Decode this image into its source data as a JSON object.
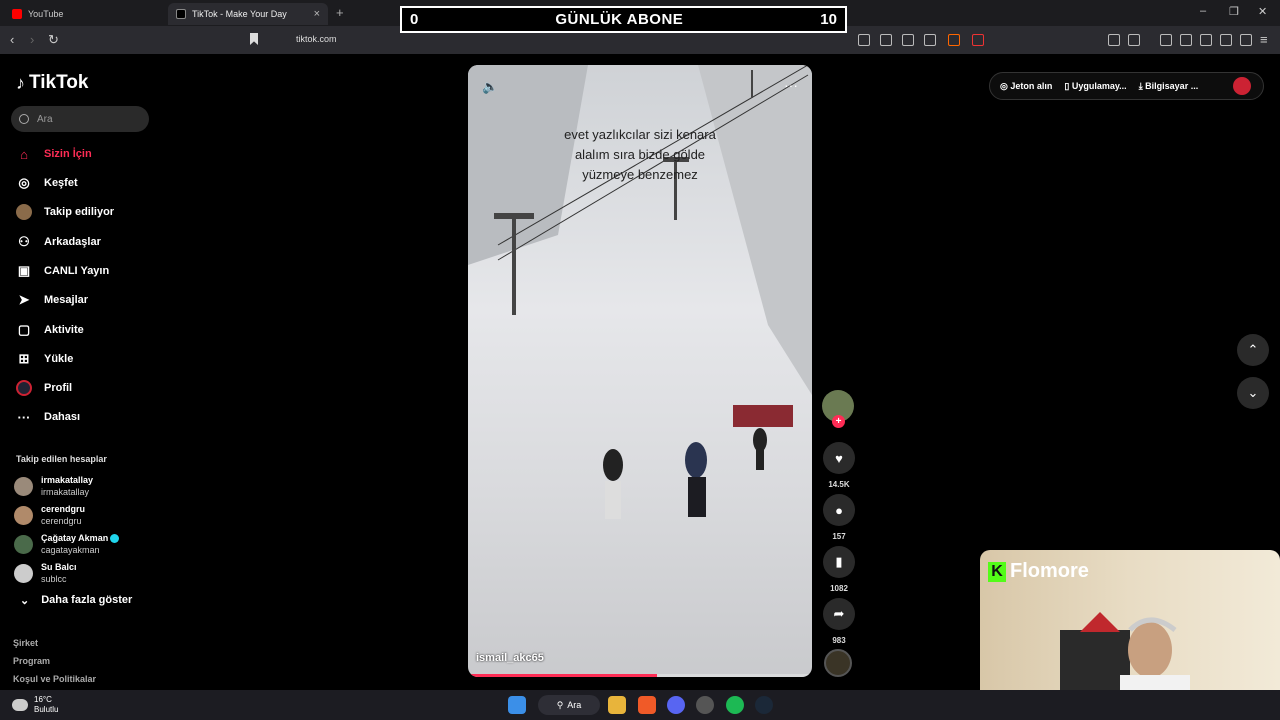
{
  "browser": {
    "tabs": [
      {
        "label": "YouTube",
        "color": "#ff0000"
      },
      {
        "label": "TikTok - Make Your Day",
        "color": "#000000"
      }
    ],
    "url": "tiktok.com"
  },
  "stream_overlay": {
    "left_count": "0",
    "title": "GÜNLÜK ABONE",
    "right_count": "10"
  },
  "sidebar": {
    "logo": "TikTok",
    "search_placeholder": "Ara",
    "items": [
      {
        "label": "Sizin İçin",
        "icon": "home-icon",
        "active": true
      },
      {
        "label": "Keşfet",
        "icon": "compass-icon"
      },
      {
        "label": "Takip ediliyor",
        "icon": "following-avatar-icon"
      },
      {
        "label": "Arkadaşlar",
        "icon": "friends-icon"
      },
      {
        "label": "CANLI Yayın",
        "icon": "live-icon"
      },
      {
        "label": "Mesajlar",
        "icon": "message-icon"
      },
      {
        "label": "Aktivite",
        "icon": "activity-icon"
      },
      {
        "label": "Yükle",
        "icon": "upload-icon"
      },
      {
        "label": "Profil",
        "icon": "profile-icon"
      },
      {
        "label": "Dahası",
        "icon": "more-icon"
      }
    ],
    "following_title": "Takip edilen hesaplar",
    "following": [
      {
        "name": "irmakatallay",
        "handle": "irmakatallay",
        "verified": false
      },
      {
        "name": "cerendgru",
        "handle": "cerendgru",
        "verified": false
      },
      {
        "name": "Çağatay Akman",
        "handle": "cagatayakman",
        "verified": true
      },
      {
        "name": "Su Balcı",
        "handle": "sublcc",
        "verified": false
      }
    ],
    "show_more": "Daha fazla göster",
    "footer": [
      "Şirket",
      "Program",
      "Koşul ve Politikalar"
    ]
  },
  "video": {
    "caption_lines": [
      "evet yazlıkcılar sizi kenara",
      "alalım sıra bizde gölde",
      "yüzmeye benzemez"
    ],
    "author": "ismail_akc65",
    "progress": 0.55
  },
  "actions": {
    "likes": "14.5K",
    "comments": "157",
    "saves": "1082",
    "shares": "983"
  },
  "topbar": {
    "coins": "Jeton alın",
    "app": "Uygulamay...",
    "pc": "Bilgisayar ..."
  },
  "webcam": {
    "brand": "Flomore"
  },
  "taskbar": {
    "temp": "16°C",
    "weather": "Bulutlu",
    "search": "Ara"
  },
  "colors": {
    "accent": "#fe2c55",
    "kick": "#53fc18"
  }
}
